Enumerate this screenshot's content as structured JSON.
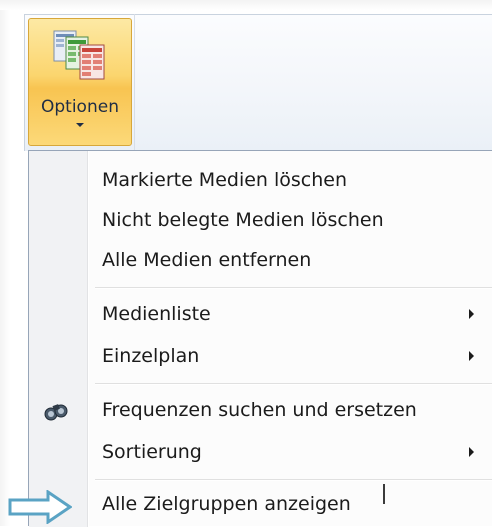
{
  "ribbon": {
    "options_button": {
      "label": "Optionen",
      "icon": "options-tables-icon"
    }
  },
  "menu": {
    "items": [
      {
        "label": "Markierte Medien löschen",
        "submenu": false,
        "icon": null
      },
      {
        "label": "Nicht belegte Medien löschen",
        "submenu": false,
        "icon": null
      },
      {
        "label": "Alle Medien entfernen",
        "submenu": false,
        "icon": null
      },
      {
        "label": "Medienliste",
        "submenu": true,
        "icon": null
      },
      {
        "label": "Einzelplan",
        "submenu": true,
        "icon": null
      },
      {
        "label": "Frequenzen suchen und ersetzen",
        "submenu": false,
        "icon": "binoculars-icon"
      },
      {
        "label": "Sortierung",
        "submenu": true,
        "icon": null
      },
      {
        "label": "Alle Zielgruppen anzeigen",
        "submenu": false,
        "icon": null
      }
    ]
  },
  "annotation": {
    "arrow_icon": "callout-arrow-icon",
    "arrow_color": "#5aa3c4"
  },
  "colors": {
    "button_pressed": "#fbd56e",
    "menu_background": "#fcfcfc",
    "menu_gutter": "#f1f2f4",
    "text": "#1b1b1b"
  }
}
